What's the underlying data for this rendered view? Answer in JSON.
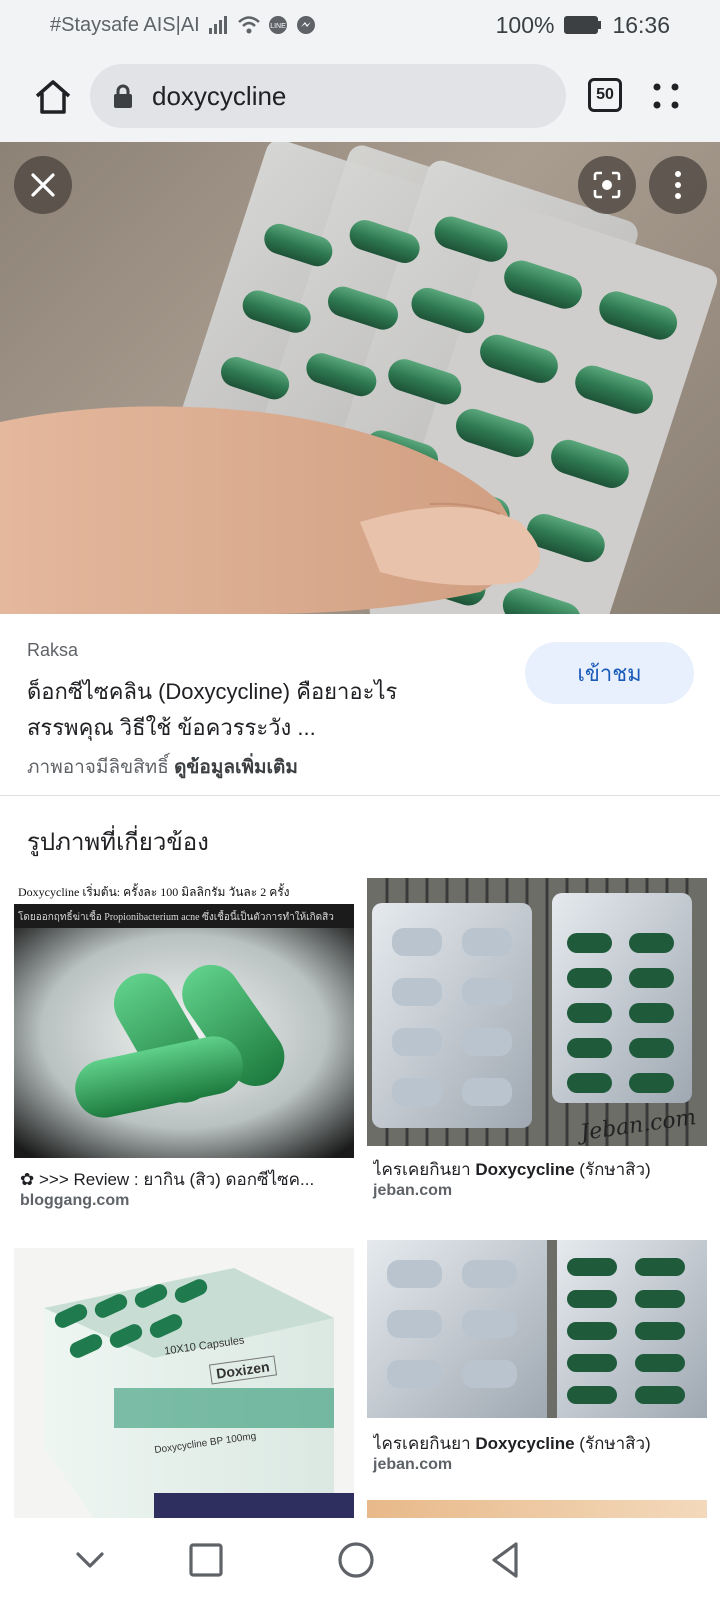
{
  "status_bar": {
    "carrier": "#Staysafe AIS|AI",
    "battery": "100%",
    "time": "16:36"
  },
  "browser": {
    "url": "doxycycline",
    "tab_count": "50"
  },
  "result": {
    "source": "Raksa",
    "title_line1": "ด็อกซีไซคลิน (Doxycycline) คือยาอะไร",
    "title_line2": "สรรพคุณ วิธีใช้ ข้อควรระวัง ...",
    "visit_label": "เข้าชม",
    "copyright_text": "ภาพอาจมีลิขสิทธิ์",
    "more_info": "ดูข้อมูลเพิ่มเติม"
  },
  "related": {
    "heading": "รูปภาพที่เกี่ยวข้อง",
    "items": [
      {
        "img_text_top": "Doxycycline เริ่มต้น: ครั้งละ 100 มิลลิกรัม วันละ 2 ครั้ง",
        "img_text_sub": "โดยออกฤทธิ์ฆ่าเชื้อ Propionibacterium acne ซึ่งเชื้อนี้เป็นตัวการทำให้เกิดสิว",
        "caption": "✿ >>> Review : ยากิน (สิว) ดอกซีไซค...",
        "domain": "bloggang.com"
      },
      {
        "caption_plain": "ไครเคยกินยา ",
        "caption_bold": "Doxycycline",
        "caption_end": " (รักษาสิว)",
        "domain": "jeban.com",
        "watermark": "Jeban.com"
      },
      {
        "label_top": "10X10 Capsules",
        "brand": "Doxizen",
        "label_bottom": "Doxycycline BP 100mg"
      },
      {
        "caption_plain": "ไครเคยกินยา ",
        "caption_bold": "Doxycycline",
        "caption_end": " (รักษาสิว)",
        "domain": "jeban.com"
      }
    ]
  },
  "icons": {
    "home": "home-icon",
    "lock": "lock-icon",
    "close": "close-icon",
    "lens": "lens-icon",
    "more": "more-vert-icon"
  },
  "colors": {
    "chrome_bg": "#f1f3f4",
    "capsule_green": "#2f7a52",
    "visit_bg": "#e8f0fe",
    "visit_text": "#1a5ab8"
  }
}
